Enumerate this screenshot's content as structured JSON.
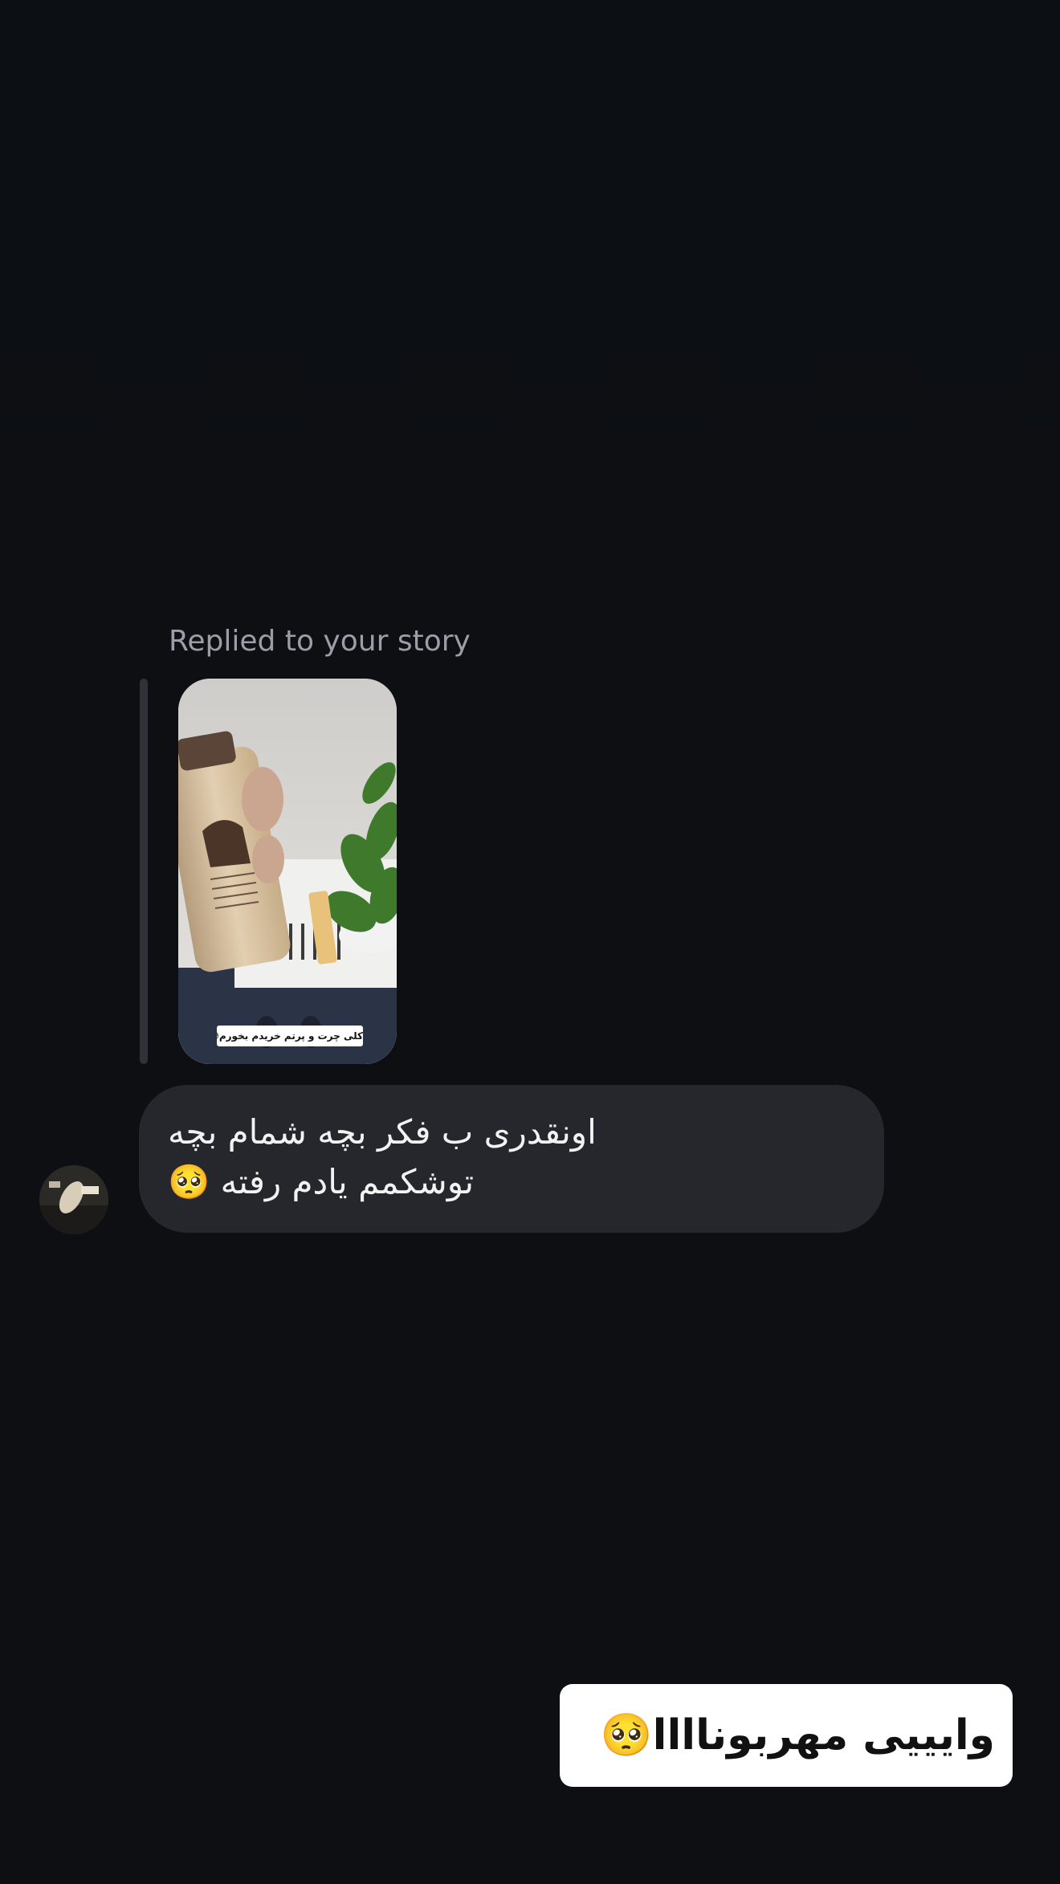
{
  "story_reply": {
    "label": "Replied to your story",
    "thumbnail_icon": "story-thumbnail",
    "caption": "کلی چرت و پرتم خریدم بخورم😅👍"
  },
  "incoming_message": {
    "text": "اونقدری ب فکر بچه شمام بچه توشکمم یادم رفته 🥺",
    "avatar_icon": "user-avatar",
    "bubble_color": "#25272c"
  },
  "outgoing_message": {
    "text": "وایییی مهربوناااا🥺",
    "bubble_color": "#ffffff"
  },
  "theme": {
    "background": "#0d0f13",
    "secondary_text": "#9a9ea6"
  }
}
